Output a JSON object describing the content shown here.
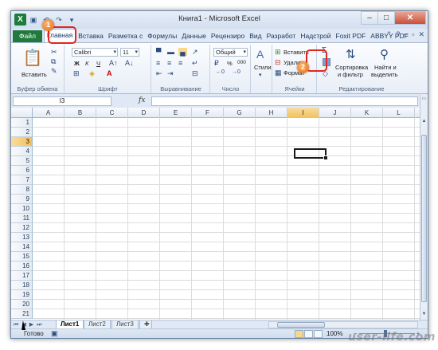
{
  "window": {
    "title": "Книга1  -  Microsoft Excel",
    "app_icon": "X",
    "controls": {
      "minimize": "–",
      "maximize": "□",
      "close": "✕"
    },
    "qat": [
      "save-icon",
      "undo-icon",
      "redo-icon",
      "customize-icon"
    ]
  },
  "tabs": [
    "Файл",
    "Главная",
    "Вставка",
    "Разметка с",
    "Формулы",
    "Данные",
    "Рецензиро",
    "Вид",
    "Разработ",
    "Надстрой",
    "Foxit PDF",
    "ABBYY PDF"
  ],
  "active_tab": "Главная",
  "ribbon": {
    "clipboard": {
      "label": "Буфер обмена",
      "paste": "Вставить"
    },
    "font": {
      "label": "Шрифт",
      "name": "Calibri",
      "size": "11",
      "bold": "Ж",
      "italic": "К",
      "underline": "Ч"
    },
    "alignment": {
      "label": "Выравнивание"
    },
    "number": {
      "label": "Число",
      "format": "Общий",
      "percent": "%",
      "thousands": "000"
    },
    "styles": {
      "label": "Стили"
    },
    "cells": {
      "label": "Ячейки",
      "insert": "Вставить",
      "delete": "Удалить",
      "format": "Формат"
    },
    "editing": {
      "label": "Редактирование",
      "sort_line1": "Сортировка",
      "sort_line2": "и фильтр",
      "find_line1": "Найти и",
      "find_line2": "выделить"
    }
  },
  "formula_bar": {
    "name_box": "I3",
    "fx": "fx",
    "value": ""
  },
  "columns": [
    "A",
    "B",
    "C",
    "D",
    "E",
    "F",
    "G",
    "H",
    "I",
    "J",
    "K",
    "L"
  ],
  "rows": [
    "1",
    "2",
    "3",
    "4",
    "5",
    "6",
    "7",
    "8",
    "9",
    "10",
    "11",
    "12",
    "13",
    "14",
    "15",
    "16",
    "17",
    "18",
    "19",
    "20",
    "21"
  ],
  "selected_col": "I",
  "selected_row": "3",
  "sheets": [
    "Лист1",
    "Лист2",
    "Лист3"
  ],
  "active_sheet": "Лист1",
  "status": {
    "text": "Готово",
    "zoom": "100%",
    "zoom_minus": "−",
    "zoom_plus": "+"
  },
  "callouts": [
    {
      "number": "1"
    },
    {
      "number": "2"
    }
  ],
  "accent": {
    "file_tab": "#1f7a3c",
    "callout_ring": "#e3261e",
    "badge": "#e56c12",
    "selection": "#f1c05a"
  },
  "watermark": "user-life.com"
}
